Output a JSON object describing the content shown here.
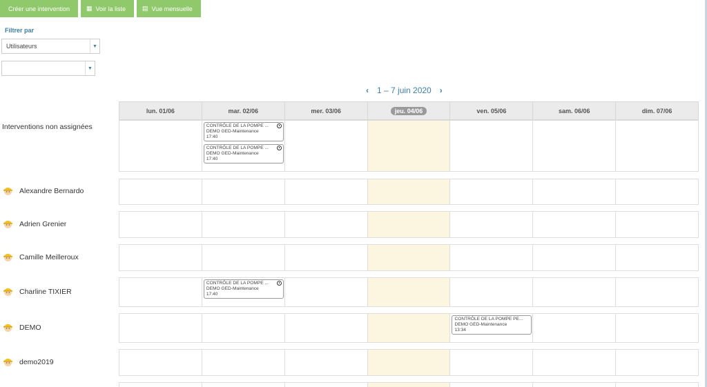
{
  "toolbar": {
    "create_label": "Créer une intervention",
    "list_label": "Voir la liste",
    "month_label": "Vue mensuelle",
    "list_icon": "grid-icon",
    "month_icon": "calendar-icon"
  },
  "filters": {
    "label": "Filtrer par",
    "select1_value": "Utilisateurs",
    "select2_value": ""
  },
  "nav": {
    "range": "1 – 7 juin 2020",
    "prev": "‹",
    "next": "›"
  },
  "days": [
    "lun. 01/06",
    "mar. 02/06",
    "mer. 03/06",
    "jeu. 04/06",
    "ven. 05/06",
    "sam. 06/06",
    "dim. 07/06"
  ],
  "today_index": 3,
  "rows": [
    {
      "label": "Interventions non assignées",
      "avatar": false,
      "events": [
        {
          "day": 1,
          "title": "CONTRÔLE DE LA POMPE ...",
          "client": "DEMO GED-Maintenance",
          "time": "17:40",
          "clock": true
        },
        {
          "day": 1,
          "title": "CONTRÔLE DE LA POMPE ...",
          "client": "DEMO GED-Maintenance",
          "time": "17:40",
          "clock": true
        }
      ]
    },
    {
      "label": "Alexandre Bernardo",
      "avatar": true,
      "events": []
    },
    {
      "label": "Adrien Grenier",
      "avatar": true,
      "events": []
    },
    {
      "label": "Camille Meilleroux",
      "avatar": true,
      "events": []
    },
    {
      "label": "Charline TIXIER",
      "avatar": true,
      "events": [
        {
          "day": 1,
          "title": "CONTRÔLE DE LA POMPE ...",
          "client": "DEMO GED-Maintenance",
          "time": "17:40",
          "clock": true
        }
      ]
    },
    {
      "label": "DEMO",
      "avatar": true,
      "events": [
        {
          "day": 4,
          "title": "CONTRÔLE DE LA POMPE PE...",
          "client": "DEMO GED-Maintenance",
          "time": "13:34",
          "clock": false
        }
      ]
    },
    {
      "label": "demo2019",
      "avatar": true,
      "events": []
    },
    {
      "label": "",
      "avatar": false,
      "events": []
    }
  ],
  "colors": {
    "button_green": "#8fc96b",
    "accent_blue": "#3f7fa6",
    "today_bg": "#fcf5e0"
  }
}
